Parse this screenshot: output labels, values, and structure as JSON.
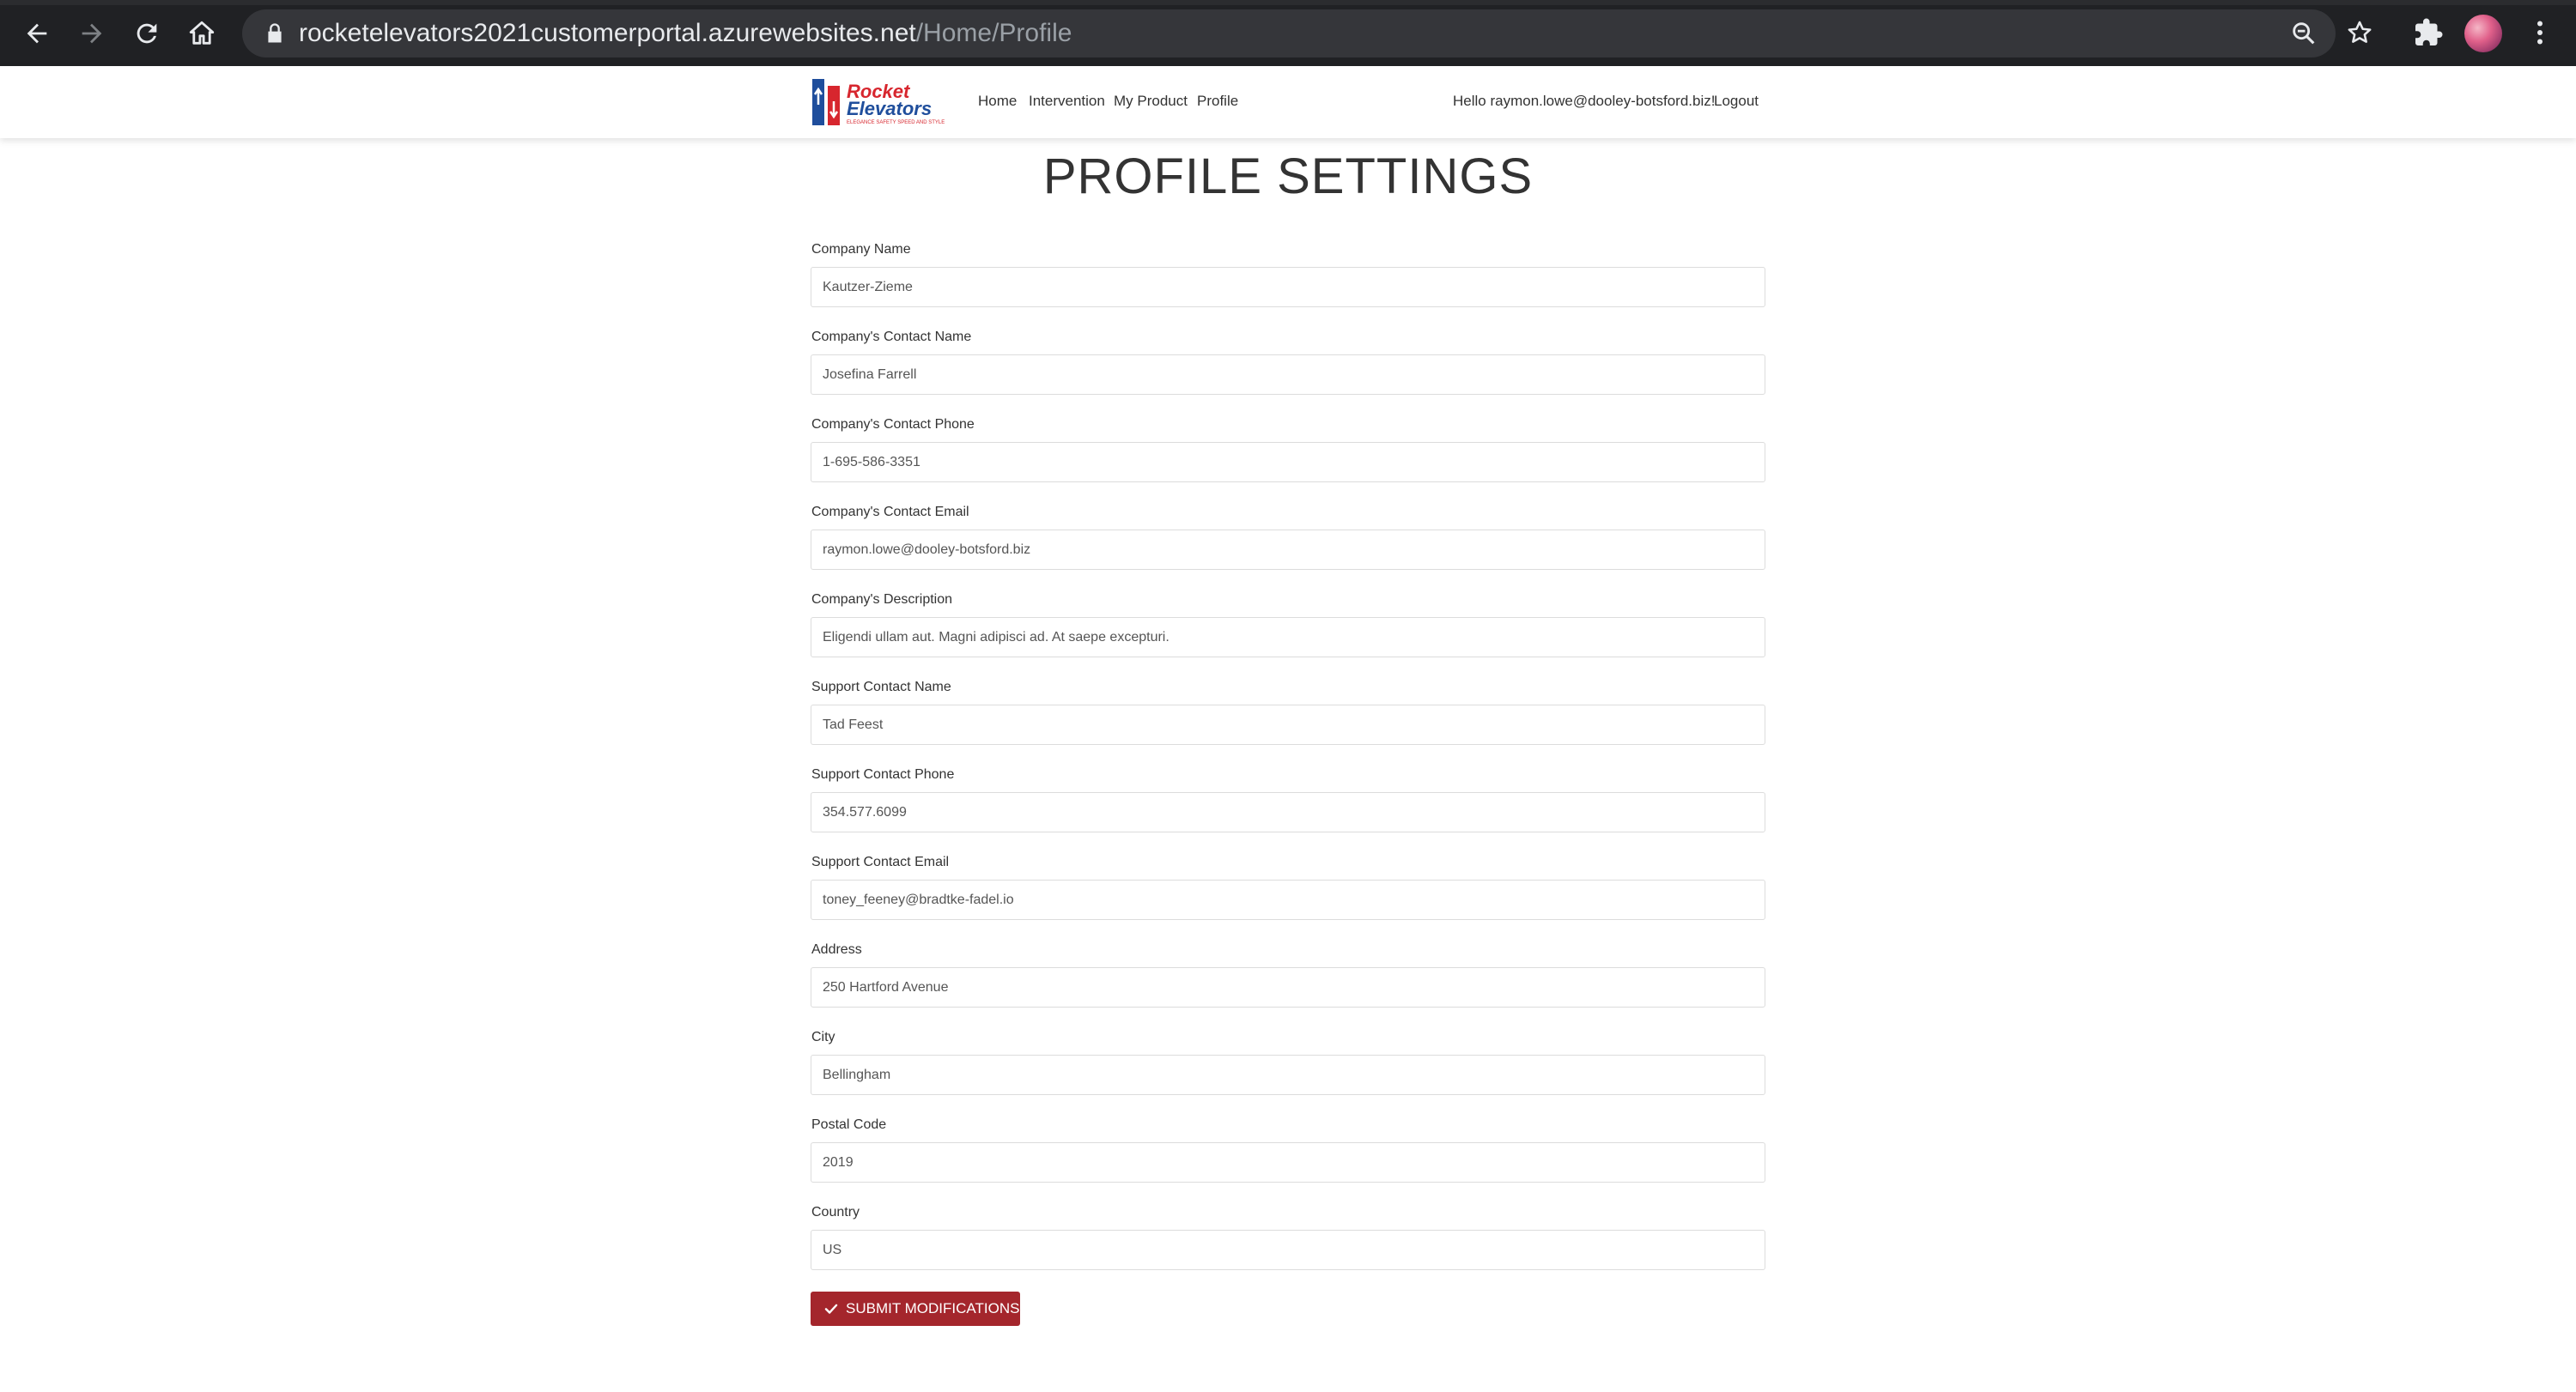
{
  "browser": {
    "url_host": "rocketelevators2021customerportal.azurewebsites.net",
    "url_path": "/Home/Profile",
    "icons": {
      "back": "back-arrow-icon",
      "forward": "forward-arrow-icon",
      "reload": "reload-icon",
      "home": "home-icon",
      "lock": "lock-icon",
      "zoom": "zoom-icon",
      "bookmark": "star-icon",
      "extensions": "puzzle-icon",
      "menu": "kebab-menu-icon"
    }
  },
  "navbar": {
    "logo_text_line1": "Rocket",
    "logo_text_line2": "Elevators",
    "logo_tagline": "ELEGANCE SAFETY SPEED AND STYLE",
    "links": [
      "Home",
      "Intervention",
      "My Product",
      "Profile"
    ],
    "greeting": "Hello raymon.lowe@dooley-botsford.biz!",
    "logout": "Logout"
  },
  "page": {
    "title": "PROFILE SETTINGS",
    "fields": [
      {
        "label": "Company Name",
        "value": "Kautzer-Zieme"
      },
      {
        "label": "Company's Contact Name",
        "value": "Josefina Farrell"
      },
      {
        "label": "Company's Contact Phone",
        "value": "1-695-586-3351"
      },
      {
        "label": "Company's Contact Email",
        "value": "raymon.lowe@dooley-botsford.biz"
      },
      {
        "label": "Company's Description",
        "value": "Eligendi ullam aut. Magni adipisci ad. At saepe excepturi."
      },
      {
        "label": "Support Contact Name",
        "value": "Tad Feest"
      },
      {
        "label": "Support Contact Phone",
        "value": "354.577.6099"
      },
      {
        "label": "Support Contact Email",
        "value": "toney_feeney@bradtke-fadel.io"
      },
      {
        "label": "Address",
        "value": "250 Hartford Avenue"
      },
      {
        "label": "City",
        "value": "Bellingham"
      },
      {
        "label": "Postal Code",
        "value": "2019"
      },
      {
        "label": "Country",
        "value": "US"
      }
    ],
    "submit_label": "SUBMIT MODIFICATIONS"
  },
  "colors": {
    "chrome_bg": "#202124",
    "omnibox_bg": "#35363a",
    "submit_bg": "#a4262c",
    "logo_red": "#d7262e",
    "logo_blue": "#1f4e9c"
  }
}
